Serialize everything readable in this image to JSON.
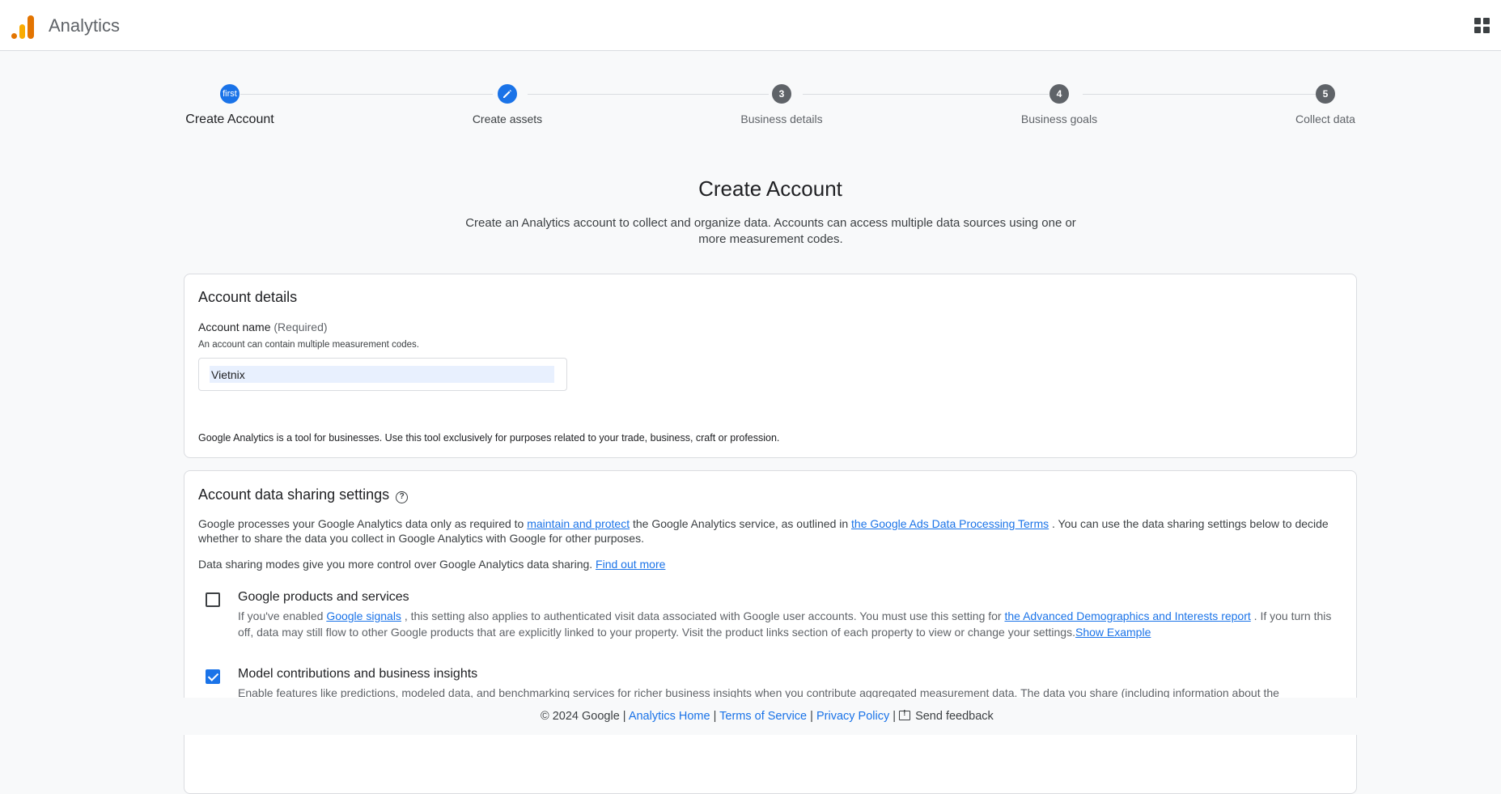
{
  "header": {
    "app_title": "Analytics",
    "apps_icon": "apps-grid-icon"
  },
  "stepper": {
    "steps": [
      {
        "number": "first",
        "label": "Create Account",
        "state": "current"
      },
      {
        "number": "",
        "label": "Create assets",
        "state": "editing",
        "icon": "pencil-icon"
      },
      {
        "number": "3",
        "label": "Business details",
        "state": "pending"
      },
      {
        "number": "4",
        "label": "Business goals",
        "state": "pending"
      },
      {
        "number": "5",
        "label": "Collect data",
        "state": "pending"
      }
    ]
  },
  "main": {
    "title": "Create Account",
    "description": "Create an Analytics account to collect and organize data. Accounts can access multiple data sources using one or more measurement codes."
  },
  "account_details": {
    "title": "Account details",
    "field_label": "Account name",
    "field_required": "(Required)",
    "field_hint": "An account can contain multiple measurement codes.",
    "account_name_value": "Vietnix",
    "notice": "Google Analytics is a tool for businesses. Use this tool exclusively for purposes related to your trade, business, craft or profession."
  },
  "data_sharing": {
    "title": "Account data sharing settings",
    "help_icon": "help-circle-icon",
    "para1_a": "Google processes your Google Analytics data only as required to",
    "para1_link1": "maintain and protect",
    "para1_b": "the Google Analytics service, as outlined in",
    "para1_link2": "the Google Ads Data Processing Terms",
    "para1_c": ". You can use the data sharing settings below to decide whether to share the data you collect in Google Analytics with Google for other purposes.",
    "para2_a": "Data sharing modes give you more control over Google Analytics data sharing.",
    "para2_link": "Find out more",
    "options": [
      {
        "title": "Google products and services",
        "checked": false,
        "desc_a": "If you've enabled",
        "desc_link1": "Google signals",
        "desc_b": ", this setting also applies to authenticated visit data associated with Google user accounts. You must use this setting for",
        "desc_link2": "the Advanced Demographics and Interests report",
        "desc_c": ". If you turn this off, data may still flow to other Google products that are explicitly linked to your property. Visit the product links section of each property to view or change your settings.",
        "desc_link3": "Show Example"
      },
      {
        "title": "Model contributions and business insights",
        "checked": true,
        "desc": "Enable features like predictions, modeled data, and benchmarking services for richer business insights when you contribute aggregated measurement data. The data you share (including information about the"
      }
    ]
  },
  "footer": {
    "copyright": "© 2024 Google",
    "link_home": "Analytics Home",
    "link_terms": "Terms of Service",
    "link_privacy": "Privacy Policy",
    "feedback": "Send feedback",
    "separator": "|"
  },
  "colors": {
    "accent": "#1a73e8",
    "logo_orange": "#e37400",
    "logo_yellow": "#f9ab00",
    "pending_step": "#5f6368"
  }
}
